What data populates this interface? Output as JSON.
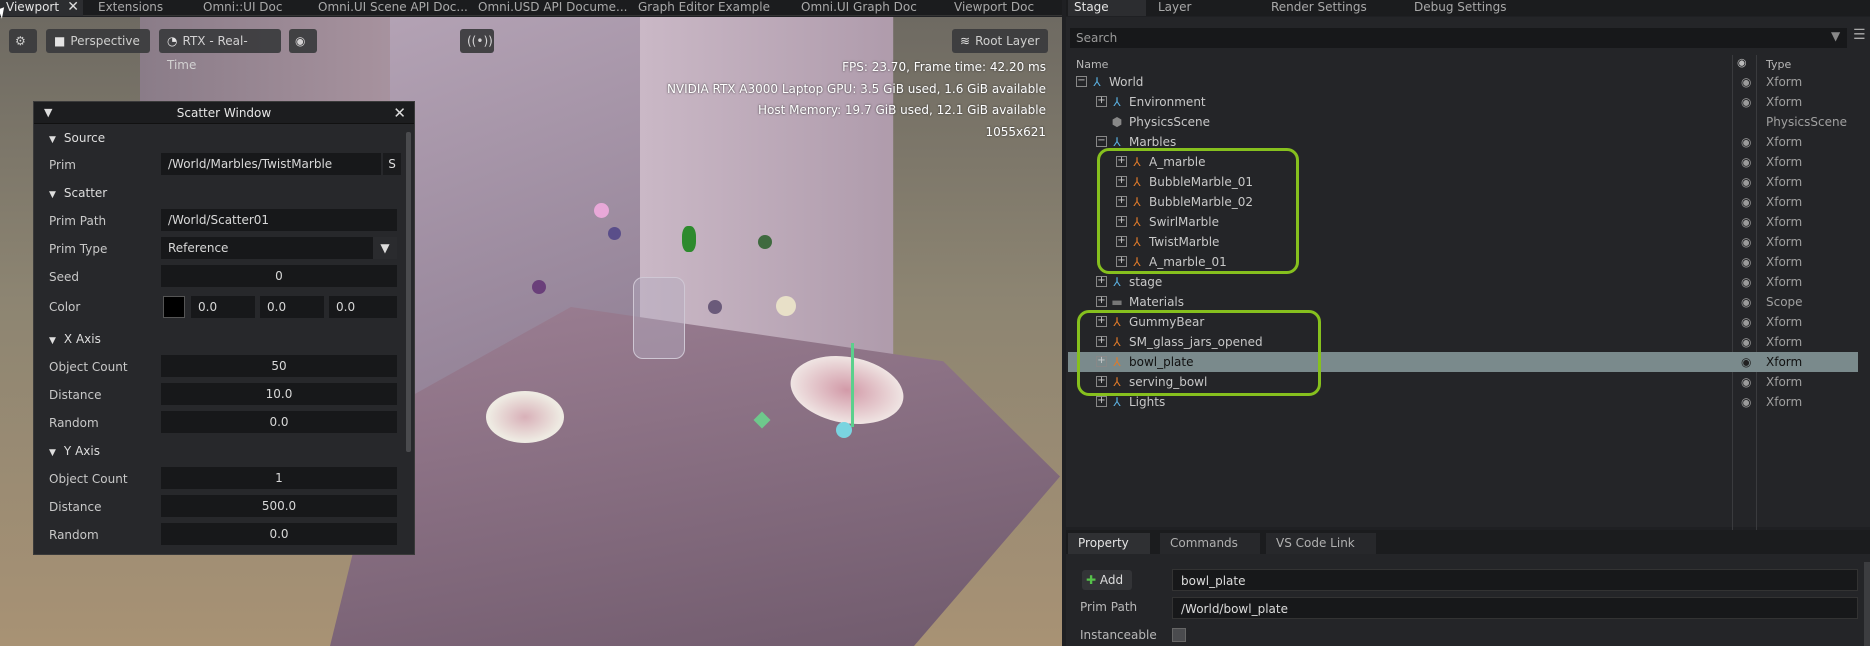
{
  "tabs": [
    "Viewport",
    "Extensions",
    "Omni::UI Doc",
    "Omni.UI Scene API Doc...",
    "Omni.USD API Docume...",
    "Graph Editor Example",
    "Omni.UI Graph Doc",
    "Viewport Doc"
  ],
  "tab_close": "✕",
  "viewport": {
    "camera": "Perspective",
    "renderer": "RTX - Real-Time",
    "root_layer": "Root Layer",
    "hud": [
      "FPS: 23.70, Frame time: 42.20 ms",
      "NVIDIA RTX A3000 Laptop GPU: 3.5 GiB used,  1.6 GiB available",
      "Host Memory: 19.7 GiB used, 12.1 GiB available",
      "1055x621"
    ]
  },
  "scatter": {
    "title": "Scatter Window",
    "source_header": "Source",
    "prim_label": "Prim",
    "prim_value": "/World/Marbles/TwistMarble",
    "prim_btn": "S",
    "scatter_header": "Scatter",
    "prim_path_label": "Prim Path",
    "prim_path_value": "/World/Scatter01",
    "prim_type_label": "Prim Type",
    "prim_type_value": "Reference",
    "seed_label": "Seed",
    "seed_value": "0",
    "color_label": "Color",
    "color_r": "0.0",
    "color_g": "0.0",
    "color_b": "0.0",
    "x_header": "X Axis",
    "x_count_label": "Object Count",
    "x_count": "50",
    "x_dist_label": "Distance",
    "x_dist": "10.0",
    "x_rand_label": "Random",
    "x_rand": "0.0",
    "y_header": "Y Axis",
    "y_count_label": "Object Count",
    "y_count": "1",
    "y_dist_label": "Distance",
    "y_dist": "500.0",
    "y_rand_label": "Random",
    "y_rand": "0.0"
  },
  "stage_tabs": [
    "Stage",
    "Layer",
    "Render Settings",
    "Debug Settings"
  ],
  "stage": {
    "search_placeholder": "Search",
    "col_name": "Name",
    "col_type": "Type",
    "rows": [
      {
        "name": "World",
        "type": "Xform"
      },
      {
        "name": "Environment",
        "type": "Xform"
      },
      {
        "name": "PhysicsScene",
        "type": "PhysicsScene"
      },
      {
        "name": "Marbles",
        "type": "Xform"
      },
      {
        "name": "A_marble",
        "type": "Xform"
      },
      {
        "name": "BubbleMarble_01",
        "type": "Xform"
      },
      {
        "name": "BubbleMarble_02",
        "type": "Xform"
      },
      {
        "name": "SwirlMarble",
        "type": "Xform"
      },
      {
        "name": "TwistMarble",
        "type": "Xform"
      },
      {
        "name": "A_marble_01",
        "type": "Xform"
      },
      {
        "name": "stage",
        "type": "Xform"
      },
      {
        "name": "Materials",
        "type": "Scope"
      },
      {
        "name": "GummyBear",
        "type": "Xform"
      },
      {
        "name": "SM_glass_jars_opened",
        "type": "Xform"
      },
      {
        "name": "bowl_plate",
        "type": "Xform"
      },
      {
        "name": "serving_bowl",
        "type": "Xform"
      },
      {
        "name": "Lights",
        "type": "Xform"
      }
    ]
  },
  "prop_tabs": [
    "Property",
    "Commands",
    "VS Code Link"
  ],
  "property": {
    "add_label": "Add",
    "name_value": "bowl_plate",
    "prim_path_label": "Prim Path",
    "prim_path_value": "/World/bowl_plate",
    "instanceable_label": "Instanceable"
  },
  "colors": {
    "highlight": "#86c01e",
    "selected_row": "#7a8a8c"
  }
}
